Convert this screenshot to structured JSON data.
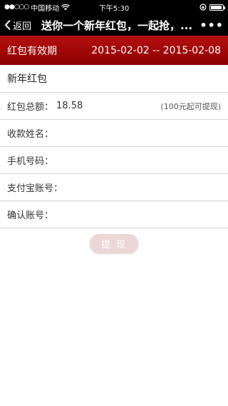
{
  "status": {
    "carrier": "中国移动",
    "time": "下午5:30"
  },
  "nav": {
    "back_label": "返回",
    "title": "送你一个新年红包，一起抢，...",
    "more_icon": "more-dots-icon"
  },
  "header": {
    "validity_label": "红包有效期",
    "validity_range": "2015-02-02 -- 2015-02-08"
  },
  "form": {
    "title": "新年红包",
    "amount_label": "红包总额：",
    "amount_value": "18.58",
    "amount_note": "(100元起可提现)",
    "name_label": "收款姓名：",
    "phone_label": "手机号码：",
    "alipay_label": "支付宝账号：",
    "confirm_label": "确认账号："
  },
  "button": {
    "withdraw_label": "提 现"
  },
  "colors": {
    "header_band": "#a30808",
    "button": "#ecd6d6"
  }
}
